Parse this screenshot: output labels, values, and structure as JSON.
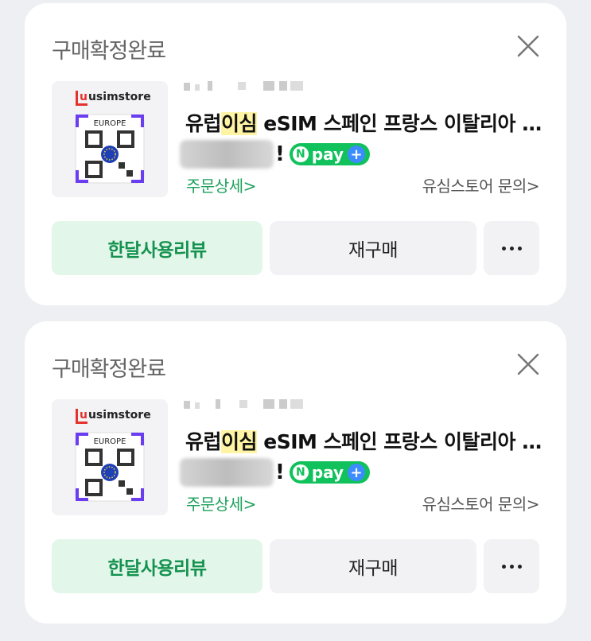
{
  "cards": [
    {
      "status": "구매확정완료",
      "thumb_logo": "usimstore",
      "thumb_region": "EUROPE",
      "title_prefix": "유럽",
      "title_highlight": "이심",
      "title_rest": " eSIM 스페인 프랑스 이탈리아 스위스",
      "excl": "!",
      "npay_label": "pay",
      "npay_n": "N",
      "npay_plus": "+",
      "order_detail": "주문상세>",
      "store_inquiry": "유심스토어 문의>",
      "review_btn": "한달사용리뷰",
      "rebuy_btn": "재구매"
    },
    {
      "status": "구매확정완료",
      "thumb_logo": "usimstore",
      "thumb_region": "EUROPE",
      "title_prefix": "유럽",
      "title_highlight": "이심",
      "title_rest": " eSIM 스페인 프랑스 이탈리아 스위스",
      "excl": "!",
      "npay_label": "pay",
      "npay_n": "N",
      "npay_plus": "+",
      "order_detail": "주문상세>",
      "store_inquiry": "유심스토어 문의>",
      "review_btn": "한달사용리뷰",
      "rebuy_btn": "재구매"
    }
  ],
  "colors": {
    "accent_green": "#1ea05c",
    "review_bg": "#e3f6ea",
    "highlight": "#fff4a3",
    "npay_green": "#11c15b"
  }
}
